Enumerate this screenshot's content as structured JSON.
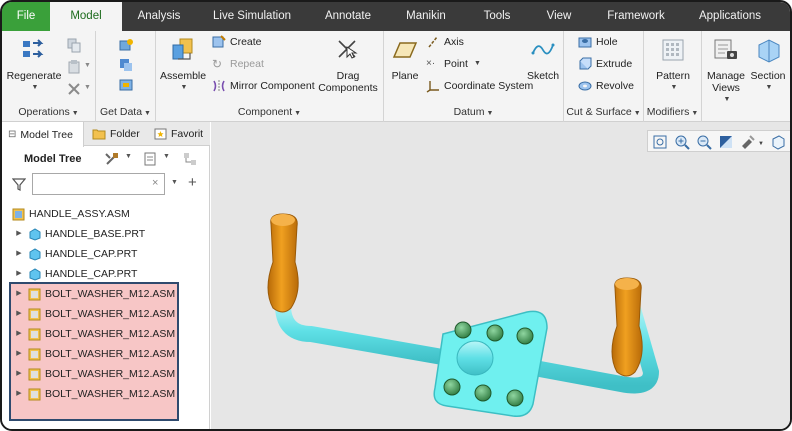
{
  "tabs": [
    "File",
    "Model",
    "Analysis",
    "Live Simulation",
    "Annotate",
    "Manikin",
    "Tools",
    "View",
    "Framework",
    "Applications"
  ],
  "active_tab": "Model",
  "ribbon": {
    "operations": {
      "regenerate": "Regenerate",
      "label": "Operations"
    },
    "get_data": {
      "label": "Get Data"
    },
    "component": {
      "assemble": "Assemble",
      "create": "Create",
      "repeat": "Repeat",
      "mirror": "Mirror Component",
      "drag": "Drag Components",
      "label": "Component"
    },
    "datum": {
      "plane": "Plane",
      "axis": "Axis",
      "point": "Point",
      "csys": "Coordinate System",
      "sketch": "Sketch",
      "label": "Datum"
    },
    "cut_surface": {
      "hole": "Hole",
      "extrude": "Extrude",
      "revolve": "Revolve",
      "label": "Cut & Surface"
    },
    "modifiers": {
      "pattern": "Pattern",
      "label": "Modifiers"
    },
    "manage_views": "Manage Views",
    "section": "Section"
  },
  "panel": {
    "tabs": [
      "Model Tree",
      "Folder",
      "Favorit"
    ],
    "tree_title": "Model Tree",
    "search": {
      "value": "",
      "placeholder": ""
    }
  },
  "tree": {
    "root": "HANDLE_ASSY.ASM",
    "items": [
      {
        "label": "HANDLE_BASE.PRT",
        "type": "part"
      },
      {
        "label": "HANDLE_CAP.PRT",
        "type": "part"
      },
      {
        "label": "HANDLE_CAP.PRT",
        "type": "part"
      },
      {
        "label": "BOLT_WASHER_M12.ASM",
        "type": "asm"
      },
      {
        "label": "BOLT_WASHER_M12.ASM",
        "type": "asm"
      },
      {
        "label": "BOLT_WASHER_M12.ASM",
        "type": "asm"
      },
      {
        "label": "BOLT_WASHER_M12.ASM",
        "type": "asm"
      },
      {
        "label": "BOLT_WASHER_M12.ASM",
        "type": "asm"
      },
      {
        "label": "BOLT_WASHER_M12.ASM",
        "type": "asm"
      }
    ]
  },
  "colors": {
    "file_tab": "#3aa03a",
    "active_tab_text": "#1c6b1c",
    "highlight": "#f7c6c6",
    "model_cyan": "#5fe0e6",
    "handle_orange": "#e08a12",
    "bolt_green": "#3f8a4e"
  },
  "icons": {
    "regenerate": "regenerate-icon",
    "assemble": "assemble-icon",
    "drag": "drag-components-icon",
    "plane": "plane-icon",
    "sketch": "sketch-icon",
    "pattern": "pattern-icon",
    "manage_views": "manage-views-icon",
    "section": "section-icon"
  }
}
